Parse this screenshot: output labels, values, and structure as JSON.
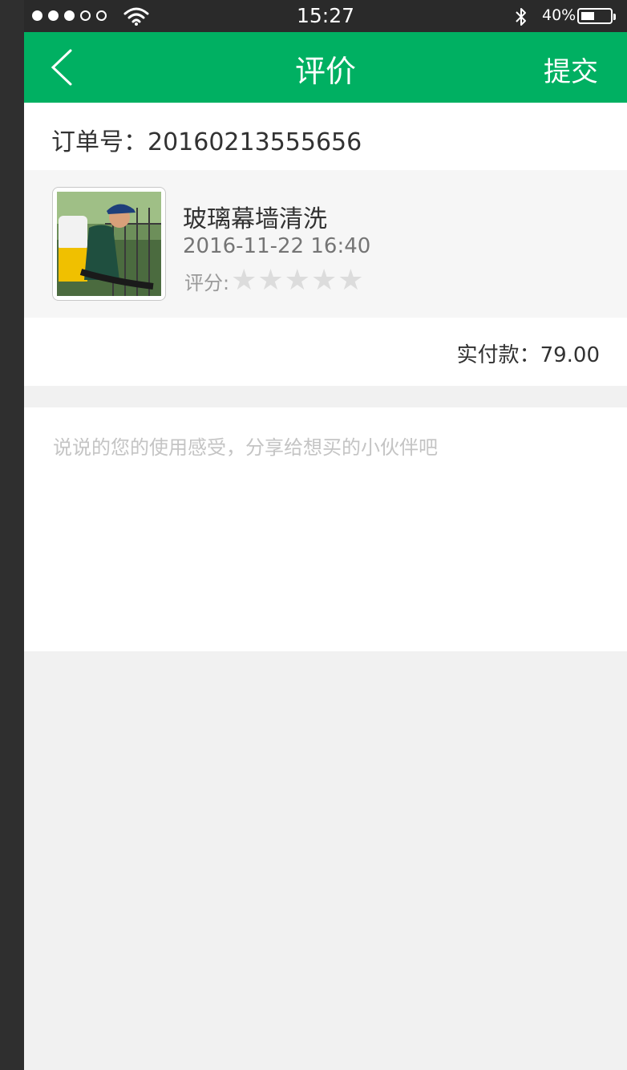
{
  "status_bar": {
    "time": "15:27",
    "battery_percent": "40%",
    "signal_filled": 3,
    "signal_total": 5,
    "icons": [
      "wifi-icon",
      "bluetooth-icon",
      "battery-icon"
    ]
  },
  "nav": {
    "title": "评价",
    "submit_label": "提交",
    "back_icon": "chevron-left-icon",
    "background_color": "#00b062"
  },
  "order": {
    "label": "订单号：20160213555656"
  },
  "product": {
    "name": "玻璃幕墙清洗",
    "datetime": "2016-11-22  16:40",
    "rating_label": "评分:",
    "rating_value": 0,
    "rating_max": 5,
    "thumbnail": "worker-with-sprayer-photo"
  },
  "payment": {
    "label": "实付款：79.00"
  },
  "comment": {
    "placeholder": "说说的您的使用感受，分享给想买的小伙伴吧",
    "value": ""
  },
  "colors": {
    "primary_text": "#323232",
    "secondary_text": "#757575",
    "placeholder": "#e1e1e1",
    "page_background": "#f1f1f1",
    "star_inactive": "#dcdcdc"
  }
}
